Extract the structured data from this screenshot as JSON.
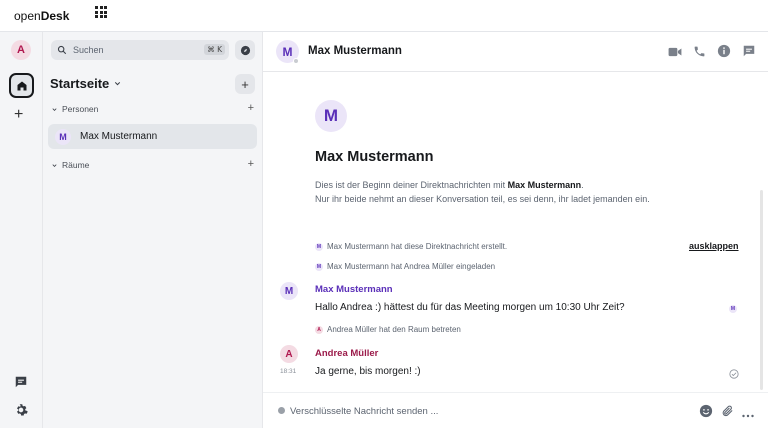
{
  "app": {
    "brand_regular": "open",
    "brand_bold": "Desk"
  },
  "rail": {
    "avatar_letter": "A"
  },
  "sidebar": {
    "search_placeholder": "Suchen",
    "search_shortcut": "⌘ K",
    "space_title": "Startseite",
    "sections": [
      {
        "label": "Personen"
      },
      {
        "label": "Räume"
      }
    ],
    "rooms": [
      {
        "avatar_letter": "M",
        "name": "Max Mustermann"
      }
    ]
  },
  "header": {
    "avatar_letter": "M",
    "room_name": "Max Mustermann"
  },
  "timeline": {
    "intro_avatar_letter": "M",
    "intro_name": "Max Mustermann",
    "intro_line1_prefix": "Dies ist der Beginn deiner Direktnachrichten mit ",
    "intro_line1_name": "Max Mustermann",
    "intro_line1_suffix": ".",
    "intro_line2": "Nur ihr beide nehmt an dieser Konversation teil, es sei denn, ihr ladet jemanden ein.",
    "expand_label": "ausklappen",
    "events": [
      {
        "avatar_letter": "M",
        "text": "Max Mustermann hat diese Direktnachricht erstellt."
      },
      {
        "avatar_letter": "M",
        "text": "Max Mustermann hat Andrea Müller eingeladen"
      },
      {
        "avatar_letter": "A",
        "text": "Andrea Müller hat den Raum betreten"
      }
    ],
    "messages": [
      {
        "avatar_letter": "M",
        "sender": "Max Mustermann",
        "body": "Hallo Andrea :) hättest du für das Meeting morgen um 10:30 Uhr Zeit?",
        "read_receipt_letter": "M",
        "sender_color": "#5a2fb8"
      },
      {
        "avatar_letter": "A",
        "sender": "Andrea Müller",
        "body": "Ja gerne, bis morgen! :)",
        "time": "18:31",
        "sender_color": "#9b1b4a"
      }
    ]
  },
  "composer": {
    "placeholder": "Verschlüsselte Nachricht senden ..."
  },
  "colors": {
    "accent_purple": "#5a2fb8",
    "accent_pink": "#b0174f",
    "sidebar_bg": "#f4f5f7"
  }
}
